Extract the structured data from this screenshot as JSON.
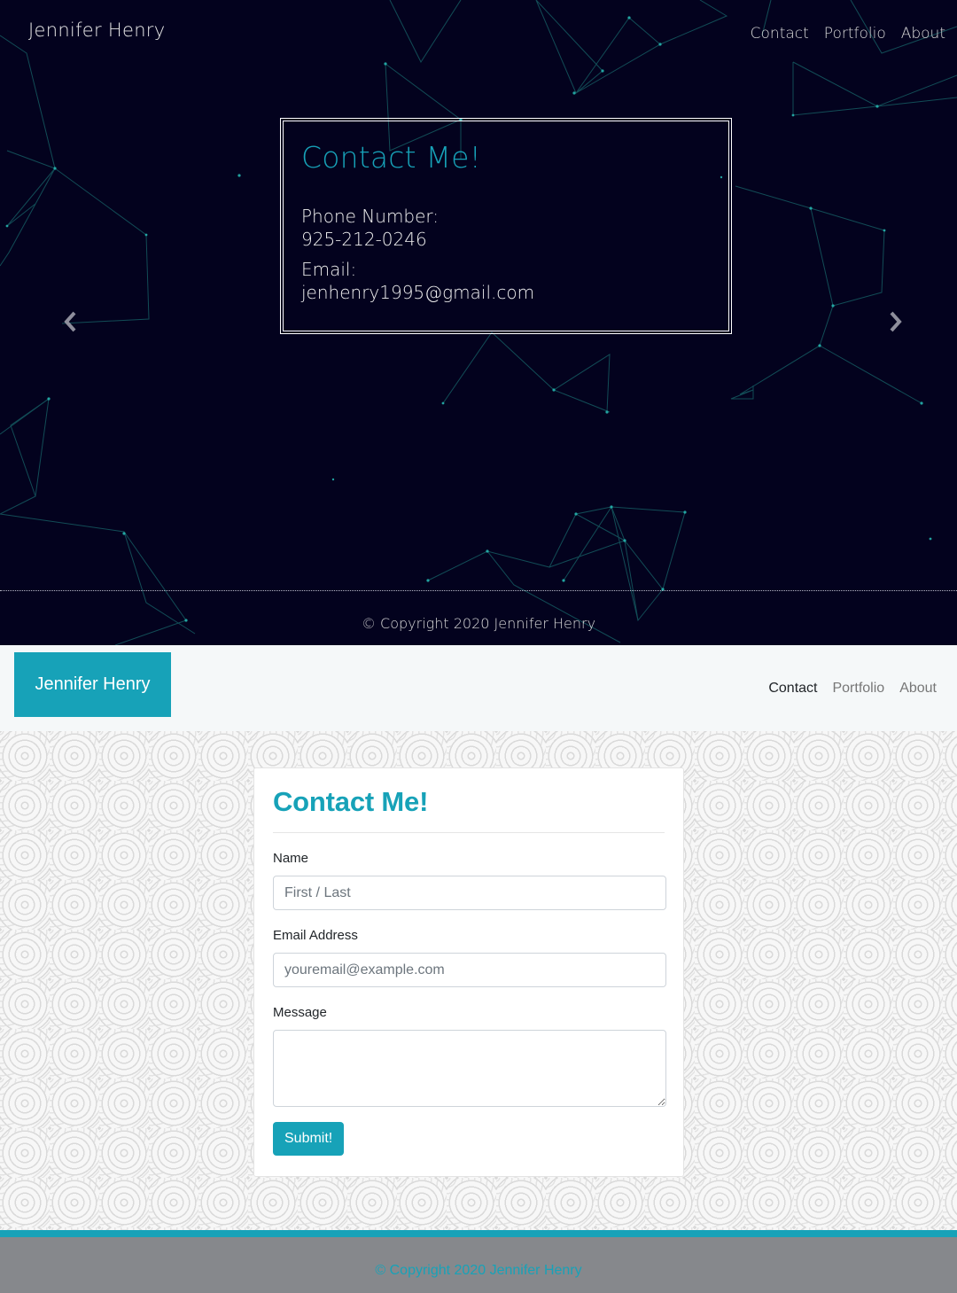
{
  "dark_page": {
    "brand": "Jennifer Henry",
    "nav": [
      "Contact",
      "Portfolio",
      "About"
    ],
    "card_title": "Contact Me!",
    "phone_label": "Phone Number:",
    "phone_value": "925-212-0246",
    "email_label": "Email:",
    "email_value": "jenhenry1995@gmail.com",
    "prev_icon": "chevron-left-icon",
    "next_icon": "chevron-right-icon",
    "footer": "© Copyright 2020 Jennifer Henry",
    "colors": {
      "background": "#03021e",
      "accent": "#17a2b8",
      "network_lines": "#1f8a85"
    }
  },
  "light_page": {
    "brand": "Jennifer Henry",
    "nav": [
      {
        "label": "Contact",
        "active": true
      },
      {
        "label": "Portfolio",
        "active": false
      },
      {
        "label": "About",
        "active": false
      }
    ],
    "form": {
      "title": "Contact Me!",
      "name_label": "Name",
      "name_placeholder": "First / Last",
      "email_label": "Email Address",
      "email_placeholder": "youremail@example.com",
      "message_label": "Message",
      "submit_label": "Submit!"
    },
    "footer": "© Copyright 2020 Jennifer Henry",
    "colors": {
      "accent": "#17a2b8",
      "nav_bg": "#f5f8f9",
      "footer_bg": "#86888c"
    }
  }
}
